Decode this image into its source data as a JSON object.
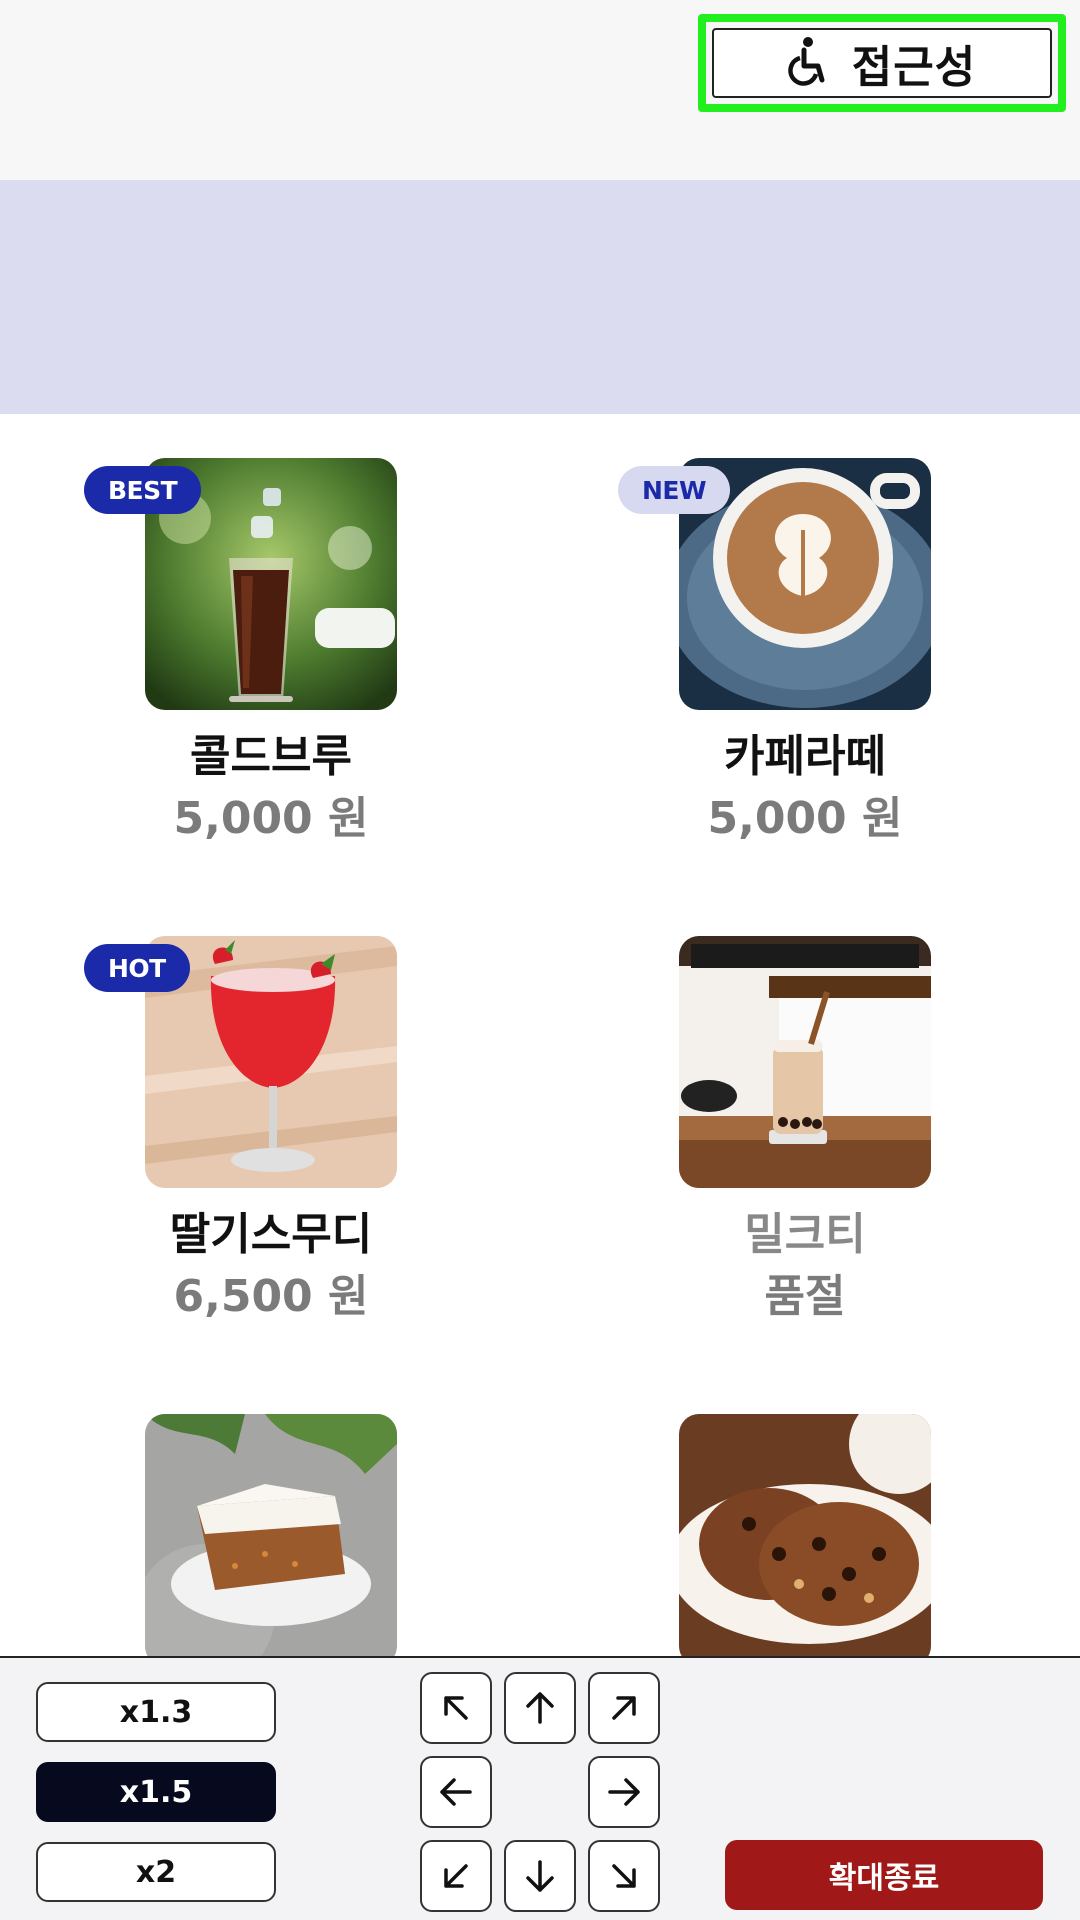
{
  "header": {
    "accessibility_label": "접근성",
    "accessibility_icon": "wheelchair-icon",
    "highlight_color": "#22f01e"
  },
  "banner": {
    "color": "#dbdcef"
  },
  "menu": {
    "items": [
      {
        "name": "콜드브루",
        "price": "5,000 원",
        "badge": "BEST",
        "image": "iced-cold-brew-photo"
      },
      {
        "name": "카페라떼",
        "price": "5,000 원",
        "badge": "NEW",
        "image": "cafe-latte-photo"
      },
      {
        "name": "딸기스무디",
        "price": "6,500 원",
        "badge": "HOT",
        "image": "strawberry-smoothie-photo"
      },
      {
        "name": "밀크티",
        "price": "품절",
        "badge": "",
        "image": "bubble-milk-tea-photo"
      },
      {
        "name": "",
        "price": "",
        "badge": "",
        "image": "carrot-cake-photo"
      },
      {
        "name": "",
        "price": "",
        "badge": "",
        "image": "chocolate-chip-cookies-photo"
      }
    ]
  },
  "controls": {
    "zoom_options": [
      "x1.3",
      "x1.5",
      "x2"
    ],
    "selected_zoom": "x1.5",
    "end_zoom_label": "확대종료",
    "end_zoom_color": "#a11818",
    "arrows": [
      "arrow-up-left-icon",
      "arrow-up-icon",
      "arrow-up-right-icon",
      "arrow-left-icon",
      "arrow-right-icon",
      "arrow-down-left-icon",
      "arrow-down-icon",
      "arrow-down-right-icon"
    ]
  }
}
